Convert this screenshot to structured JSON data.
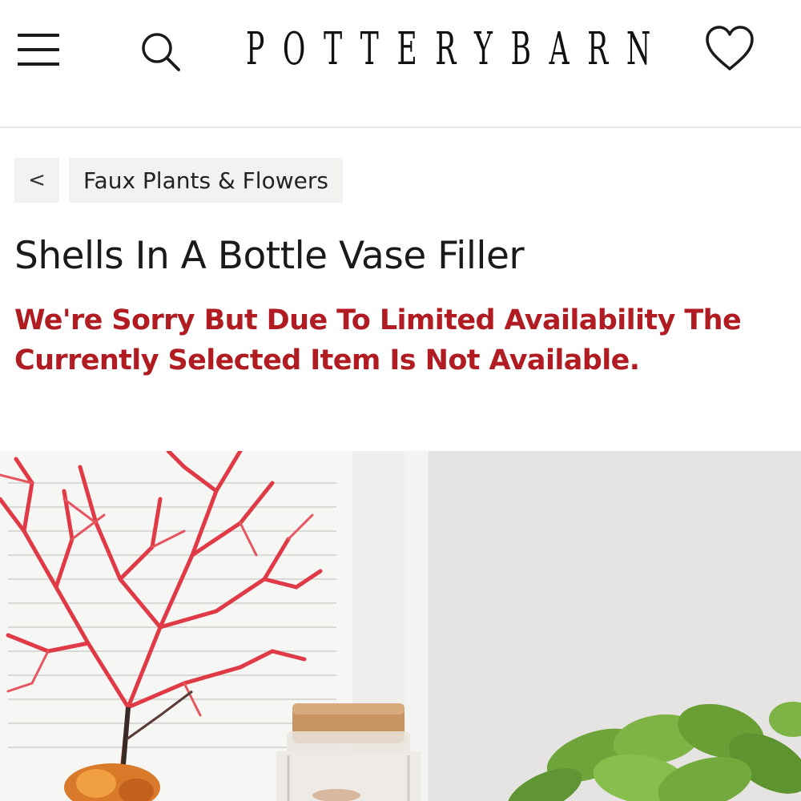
{
  "header": {
    "brand_letters": [
      "P",
      "O",
      "T",
      "T",
      "E",
      "R",
      "Y",
      "B",
      "A",
      "R",
      "N"
    ],
    "menu_icon": "hamburger-menu-icon",
    "search_icon": "search-icon",
    "wishlist_icon": "heart-icon"
  },
  "breadcrumb": {
    "back_label": "<",
    "category_label": "Faux Plants & Flowers"
  },
  "product": {
    "title": "Shells In A Bottle Vase Filler",
    "availability_message": "We're Sorry But Due To Limited Availability The Currently Selected Item Is Not Available."
  },
  "colors": {
    "error_red": "#b01c22",
    "chip_background": "#f2f2f0",
    "coral_red": "#e03a46",
    "succulent_green": "#6fa43a"
  }
}
